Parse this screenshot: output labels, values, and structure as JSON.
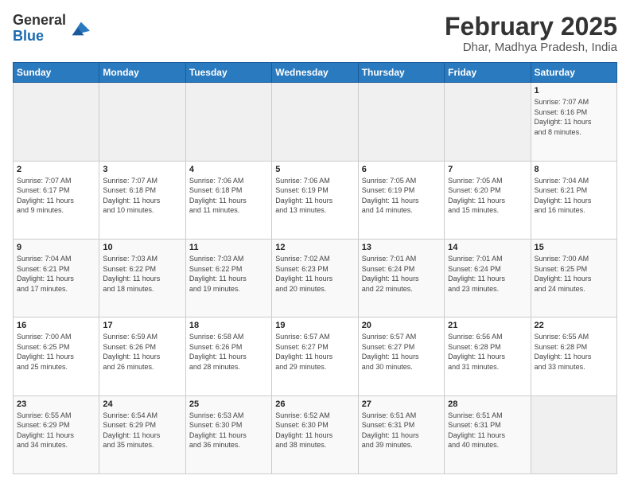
{
  "header": {
    "logo_line1": "General",
    "logo_line2": "Blue",
    "month_year": "February 2025",
    "location": "Dhar, Madhya Pradesh, India"
  },
  "weekdays": [
    "Sunday",
    "Monday",
    "Tuesday",
    "Wednesday",
    "Thursday",
    "Friday",
    "Saturday"
  ],
  "weeks": [
    [
      {
        "day": "",
        "info": ""
      },
      {
        "day": "",
        "info": ""
      },
      {
        "day": "",
        "info": ""
      },
      {
        "day": "",
        "info": ""
      },
      {
        "day": "",
        "info": ""
      },
      {
        "day": "",
        "info": ""
      },
      {
        "day": "1",
        "info": "Sunrise: 7:07 AM\nSunset: 6:16 PM\nDaylight: 11 hours\nand 8 minutes."
      }
    ],
    [
      {
        "day": "2",
        "info": "Sunrise: 7:07 AM\nSunset: 6:17 PM\nDaylight: 11 hours\nand 9 minutes."
      },
      {
        "day": "3",
        "info": "Sunrise: 7:07 AM\nSunset: 6:18 PM\nDaylight: 11 hours\nand 10 minutes."
      },
      {
        "day": "4",
        "info": "Sunrise: 7:06 AM\nSunset: 6:18 PM\nDaylight: 11 hours\nand 11 minutes."
      },
      {
        "day": "5",
        "info": "Sunrise: 7:06 AM\nSunset: 6:19 PM\nDaylight: 11 hours\nand 13 minutes."
      },
      {
        "day": "6",
        "info": "Sunrise: 7:05 AM\nSunset: 6:19 PM\nDaylight: 11 hours\nand 14 minutes."
      },
      {
        "day": "7",
        "info": "Sunrise: 7:05 AM\nSunset: 6:20 PM\nDaylight: 11 hours\nand 15 minutes."
      },
      {
        "day": "8",
        "info": "Sunrise: 7:04 AM\nSunset: 6:21 PM\nDaylight: 11 hours\nand 16 minutes."
      }
    ],
    [
      {
        "day": "9",
        "info": "Sunrise: 7:04 AM\nSunset: 6:21 PM\nDaylight: 11 hours\nand 17 minutes."
      },
      {
        "day": "10",
        "info": "Sunrise: 7:03 AM\nSunset: 6:22 PM\nDaylight: 11 hours\nand 18 minutes."
      },
      {
        "day": "11",
        "info": "Sunrise: 7:03 AM\nSunset: 6:22 PM\nDaylight: 11 hours\nand 19 minutes."
      },
      {
        "day": "12",
        "info": "Sunrise: 7:02 AM\nSunset: 6:23 PM\nDaylight: 11 hours\nand 20 minutes."
      },
      {
        "day": "13",
        "info": "Sunrise: 7:01 AM\nSunset: 6:24 PM\nDaylight: 11 hours\nand 22 minutes."
      },
      {
        "day": "14",
        "info": "Sunrise: 7:01 AM\nSunset: 6:24 PM\nDaylight: 11 hours\nand 23 minutes."
      },
      {
        "day": "15",
        "info": "Sunrise: 7:00 AM\nSunset: 6:25 PM\nDaylight: 11 hours\nand 24 minutes."
      }
    ],
    [
      {
        "day": "16",
        "info": "Sunrise: 7:00 AM\nSunset: 6:25 PM\nDaylight: 11 hours\nand 25 minutes."
      },
      {
        "day": "17",
        "info": "Sunrise: 6:59 AM\nSunset: 6:26 PM\nDaylight: 11 hours\nand 26 minutes."
      },
      {
        "day": "18",
        "info": "Sunrise: 6:58 AM\nSunset: 6:26 PM\nDaylight: 11 hours\nand 28 minutes."
      },
      {
        "day": "19",
        "info": "Sunrise: 6:57 AM\nSunset: 6:27 PM\nDaylight: 11 hours\nand 29 minutes."
      },
      {
        "day": "20",
        "info": "Sunrise: 6:57 AM\nSunset: 6:27 PM\nDaylight: 11 hours\nand 30 minutes."
      },
      {
        "day": "21",
        "info": "Sunrise: 6:56 AM\nSunset: 6:28 PM\nDaylight: 11 hours\nand 31 minutes."
      },
      {
        "day": "22",
        "info": "Sunrise: 6:55 AM\nSunset: 6:28 PM\nDaylight: 11 hours\nand 33 minutes."
      }
    ],
    [
      {
        "day": "23",
        "info": "Sunrise: 6:55 AM\nSunset: 6:29 PM\nDaylight: 11 hours\nand 34 minutes."
      },
      {
        "day": "24",
        "info": "Sunrise: 6:54 AM\nSunset: 6:29 PM\nDaylight: 11 hours\nand 35 minutes."
      },
      {
        "day": "25",
        "info": "Sunrise: 6:53 AM\nSunset: 6:30 PM\nDaylight: 11 hours\nand 36 minutes."
      },
      {
        "day": "26",
        "info": "Sunrise: 6:52 AM\nSunset: 6:30 PM\nDaylight: 11 hours\nand 38 minutes."
      },
      {
        "day": "27",
        "info": "Sunrise: 6:51 AM\nSunset: 6:31 PM\nDaylight: 11 hours\nand 39 minutes."
      },
      {
        "day": "28",
        "info": "Sunrise: 6:51 AM\nSunset: 6:31 PM\nDaylight: 11 hours\nand 40 minutes."
      },
      {
        "day": "",
        "info": ""
      }
    ]
  ]
}
